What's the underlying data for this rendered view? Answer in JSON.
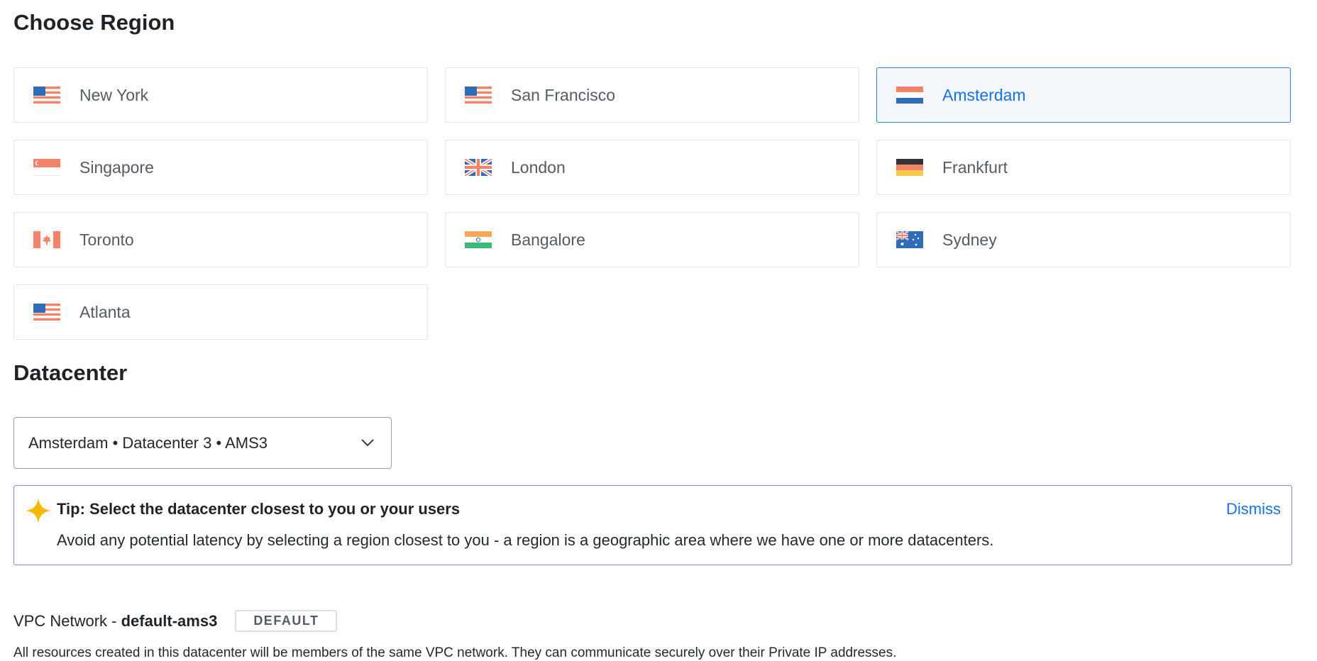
{
  "region": {
    "title": "Choose Region",
    "items": [
      {
        "label": "New York",
        "flag": "us-flag-icon"
      },
      {
        "label": "San Francisco",
        "flag": "us-flag-icon"
      },
      {
        "label": "Amsterdam",
        "flag": "netherlands-flag-icon",
        "selected": true
      },
      {
        "label": "Singapore",
        "flag": "singapore-flag-icon"
      },
      {
        "label": "London",
        "flag": "uk-flag-icon"
      },
      {
        "label": "Frankfurt",
        "flag": "germany-flag-icon"
      },
      {
        "label": "Toronto",
        "flag": "canada-flag-icon"
      },
      {
        "label": "Bangalore",
        "flag": "india-flag-icon"
      },
      {
        "label": "Sydney",
        "flag": "australia-flag-icon"
      },
      {
        "label": "Atlanta",
        "flag": "us-flag-icon"
      }
    ]
  },
  "datacenter": {
    "title": "Datacenter",
    "selected_value": "Amsterdam • Datacenter 3 • AMS3"
  },
  "tip": {
    "title": "Tip: Select the datacenter closest to you or your users",
    "body": "Avoid any potential latency by selecting a region closest to you - a region is a geographic area where we have one or more datacenters.",
    "dismiss": "Dismiss"
  },
  "vpc": {
    "prefix": "VPC Network - ",
    "name": "default-ams3",
    "badge": "DEFAULT",
    "description": "All resources created in this datacenter will be members of the same VPC network. They can communicate securely over their Private IP addresses."
  },
  "colors": {
    "accent": "#1673e0",
    "selected_border": "#2f7fd9",
    "tip_border": "#8b88d8",
    "star": "#f5b800"
  }
}
